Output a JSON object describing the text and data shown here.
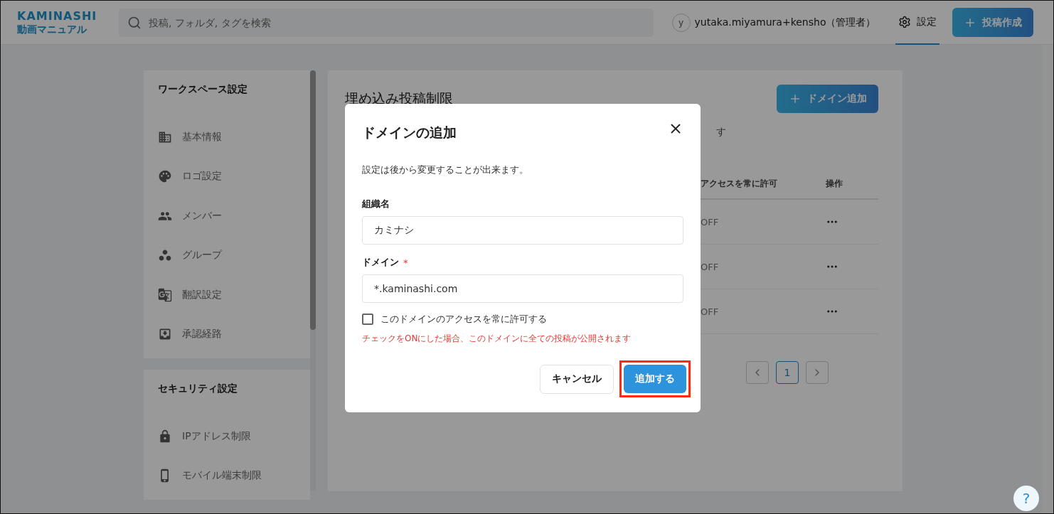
{
  "header": {
    "logo": {
      "wordmark": "KAMINASHI",
      "subtitle": "動画マニュアル"
    },
    "search": {
      "placeholder": "投稿, フォルダ, タグを検索"
    },
    "user": {
      "avatar": "y",
      "name": "yutaka.miyamura+kensho（管理者）"
    },
    "nav": [
      {
        "label": "設定",
        "selected": true
      }
    ],
    "create_button": "投稿作成"
  },
  "sidebar": {
    "sections": [
      {
        "title": "ワークスペース設定",
        "items": [
          {
            "label": "基本情報"
          },
          {
            "label": "ロゴ設定"
          },
          {
            "label": "メンバー"
          },
          {
            "label": "グループ"
          },
          {
            "label": "翻訳設定"
          },
          {
            "label": "承認経路"
          }
        ]
      },
      {
        "title": "セキュリティ設定",
        "items": [
          {
            "label": "IPアドレス制限"
          },
          {
            "label": "モバイル端末制限"
          }
        ]
      }
    ]
  },
  "main": {
    "title": "埋め込み投稿制限",
    "add_button": "ドメイン追加",
    "description_tail": "す",
    "table": {
      "columns": [
        "アクセスを常に許可",
        "操作"
      ],
      "rows": [
        {
          "access": "OFF"
        },
        {
          "access": "OFF"
        },
        {
          "access": "OFF"
        }
      ]
    },
    "pagination": {
      "pages": [
        {
          "label": "1",
          "selected": true
        }
      ]
    }
  },
  "dialog": {
    "title": "ドメインの追加",
    "note": "設定は後から変更することが出来ます。",
    "fields": [
      {
        "label": "組織名",
        "value": "カミナシ"
      },
      {
        "label": "ドメイン",
        "value": "*.kaminashi.com",
        "required_mark": "*"
      }
    ],
    "checkbox": {
      "label": "このドメインのアクセスを常に許可する",
      "checked": false
    },
    "warning": "チェックをONにした場合、このドメインに全ての投稿が公開されます",
    "cancel_button": "キャンセル",
    "submit_button": {
      "label": "追加する",
      "highlighted": true
    }
  },
  "help_button": "?"
}
